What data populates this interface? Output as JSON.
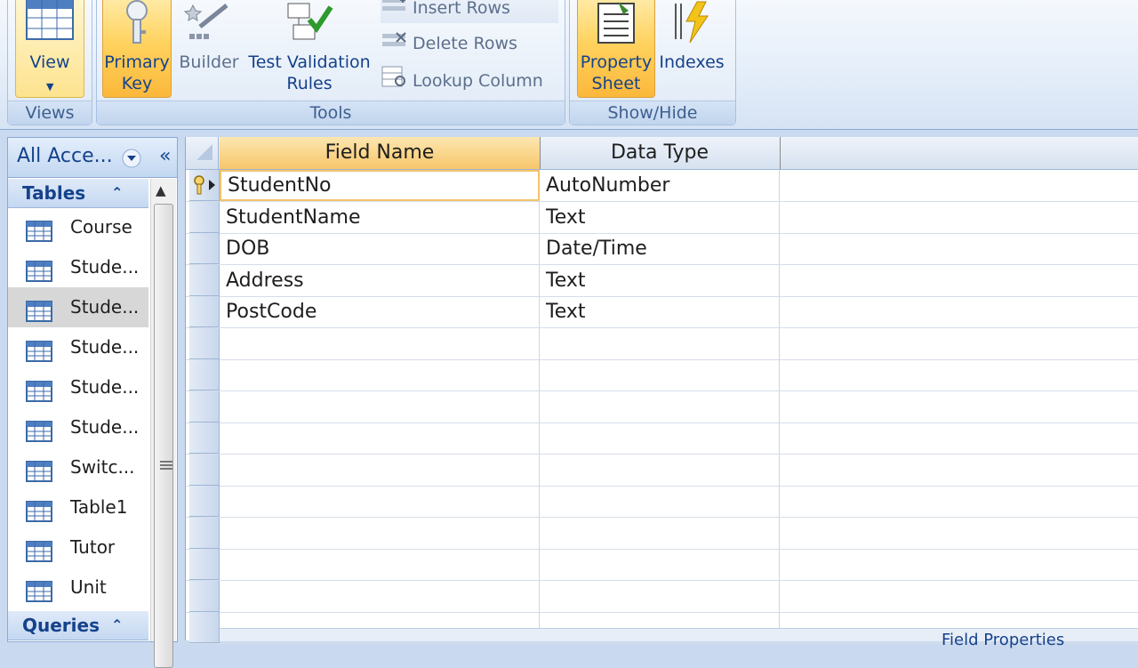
{
  "ribbon": {
    "groups": {
      "views": {
        "label": "Views",
        "view_label": "View"
      },
      "tools": {
        "label": "Tools",
        "primary_key_label": [
          "Primary",
          "Key"
        ],
        "builder_label": "Builder",
        "test_validation_label": [
          "Test Validation",
          "Rules"
        ],
        "insert_rows_label": "Insert Rows",
        "delete_rows_label": "Delete Rows",
        "lookup_column_label": "Lookup Column"
      },
      "show_hide": {
        "label": "Show/Hide",
        "property_sheet_label": [
          "Property",
          "Sheet"
        ],
        "indexes_label": "Indexes"
      }
    }
  },
  "nav": {
    "title": "All Acce...",
    "sections": {
      "tables": "Tables",
      "queries": "Queries"
    },
    "items": [
      {
        "label": "Course"
      },
      {
        "label": "Stude..."
      },
      {
        "label": "Stude...",
        "selected": true
      },
      {
        "label": "Stude..."
      },
      {
        "label": "Stude..."
      },
      {
        "label": "Stude..."
      },
      {
        "label": "Switc..."
      },
      {
        "label": "Table1"
      },
      {
        "label": "Tutor"
      },
      {
        "label": "Unit"
      }
    ]
  },
  "table": {
    "columns": [
      "Field Name",
      "Data Type"
    ],
    "rows": [
      {
        "field": "StudentNo",
        "type": "AutoNumber",
        "primary_key": true
      },
      {
        "field": "StudentName",
        "type": "Text"
      },
      {
        "field": "DOB",
        "type": "Date/Time"
      },
      {
        "field": "Address",
        "type": "Text"
      },
      {
        "field": "PostCode",
        "type": "Text"
      }
    ],
    "field_properties_label": "Field Properties"
  },
  "colors": {
    "accent_orange": "#f7c66a",
    "ribbon_text": "#15428b"
  }
}
